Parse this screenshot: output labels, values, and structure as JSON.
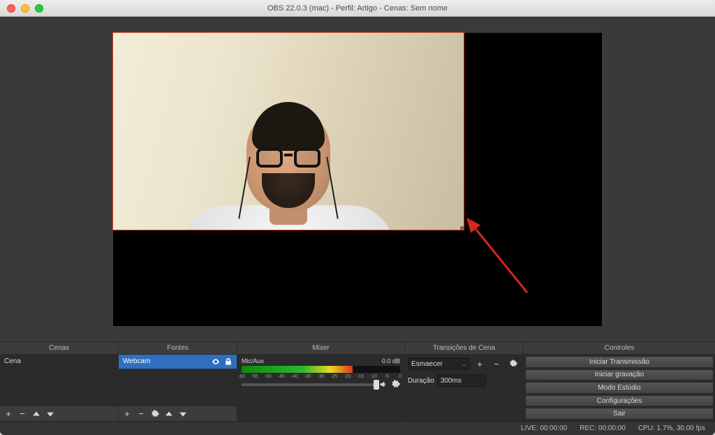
{
  "window": {
    "title": "OBS 22.0.3 (mac) - Perfil: Artigo - Cenas: Sem nome"
  },
  "panels": {
    "scenes": {
      "title": "Cenas",
      "items": [
        "Cena"
      ]
    },
    "sources": {
      "title": "Fontes",
      "items": [
        {
          "label": "Webcam",
          "visible": true,
          "locked": false,
          "selected": true
        }
      ]
    },
    "mixer": {
      "title": "Mixer",
      "channel": {
        "name": "Mic/Aux",
        "level": "0.0 dB",
        "meter_pct": 70,
        "slider_pct": 100
      },
      "tick_marks": [
        "-60",
        "-55",
        "-50",
        "-45",
        "-40",
        "-35",
        "-30",
        "-25",
        "-20",
        "-15",
        "-10",
        "-5",
        "0"
      ]
    },
    "transitions": {
      "title": "Transições de Cena",
      "selected": "Esmaecer",
      "duration_label": "Duração",
      "duration_value": "300ms"
    },
    "controls": {
      "title": "Controles",
      "buttons": [
        "Iniciar Transmissão",
        "Iniciar gravação",
        "Modo Estúdio",
        "Configurações",
        "Sair"
      ]
    }
  },
  "status": {
    "live": "LIVE: 00:00:00",
    "rec": "REC: 00:00:00",
    "cpu": "CPU: 1.7%, 30.00 fps"
  }
}
